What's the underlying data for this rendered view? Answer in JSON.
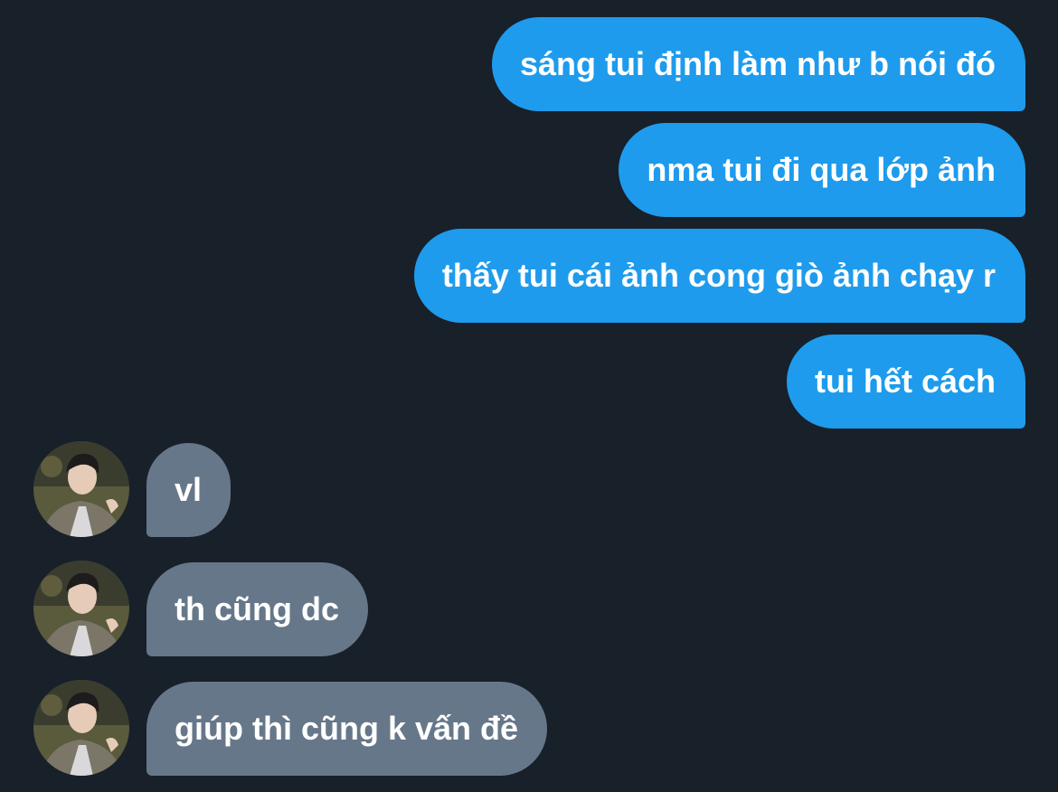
{
  "colors": {
    "background": "#18202a",
    "outgoing_bubble": "#1e9bec",
    "incoming_bubble": "#667789",
    "text": "#ffffff"
  },
  "messages": {
    "outgoing": [
      {
        "text": "sáng tui định làm như b nói đó"
      },
      {
        "text": "nma tui đi qua lớp ảnh"
      },
      {
        "text": "thấy tui cái ảnh cong giò ảnh chạy r"
      },
      {
        "text": "tui hết cách"
      }
    ],
    "incoming": [
      {
        "text": "vl",
        "avatar_icon": "user-photo-avatar"
      },
      {
        "text": "th cũng dc",
        "avatar_icon": "user-photo-avatar"
      },
      {
        "text": "giúp thì cũng k vấn đề",
        "avatar_icon": "user-photo-avatar"
      }
    ]
  }
}
